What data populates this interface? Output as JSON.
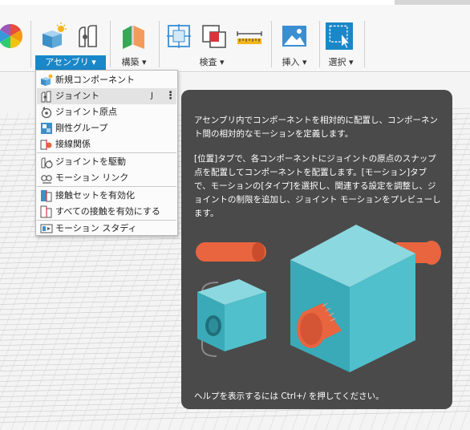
{
  "toolbar": {
    "assembly_label": "アセンブリ ▾",
    "construct_label": "構築 ▾",
    "inspect_label": "検査 ▾",
    "insert_label": "挿入 ▾",
    "select_label": "選択 ▾"
  },
  "menu": {
    "items": [
      {
        "label": "新規コンポーネント",
        "icon": "new-component-icon"
      },
      {
        "label": "ジョイント",
        "icon": "joint-icon",
        "shortcut": "J",
        "more": "⋮"
      },
      {
        "label": "ジョイント原点",
        "icon": "joint-origin-icon"
      },
      {
        "label": "剛性グループ",
        "icon": "rigid-group-icon"
      },
      {
        "label": "接線関係",
        "icon": "tangent-relationship-icon"
      },
      {
        "label": "ジョイントを駆動",
        "icon": "drive-joints-icon"
      },
      {
        "label": "モーション リンク",
        "icon": "motion-link-icon"
      },
      {
        "label": "接触セットを有効化",
        "icon": "enable-contact-sets-icon"
      },
      {
        "label": "すべての接触を有効にする",
        "icon": "enable-all-contact-icon"
      },
      {
        "label": "モーション スタディ",
        "icon": "motion-study-icon"
      }
    ]
  },
  "tooltip": {
    "paragraph1": "アセンブリ内でコンポーネントを相対的に配置し、コンポーネント間の相対的なモーションを定義します。",
    "paragraph2": "[位置]タブで、各コンポーネントにジョイントの原点のスナップ点を配置してコンポーネントを配置します。[モーション]タブで、モーションの[タイプ]を選択し、関連する設定を調整し、ジョイントの制限を追加し、ジョイント モーションをプレビューします。",
    "footer": "ヘルプを表示するには Ctrl+/ を押してください。"
  },
  "colors": {
    "accent": "#1a87c9",
    "tooltip_bg": "#4a4a4a",
    "cube": "#4fc0cc",
    "pin": "#e8653f"
  }
}
